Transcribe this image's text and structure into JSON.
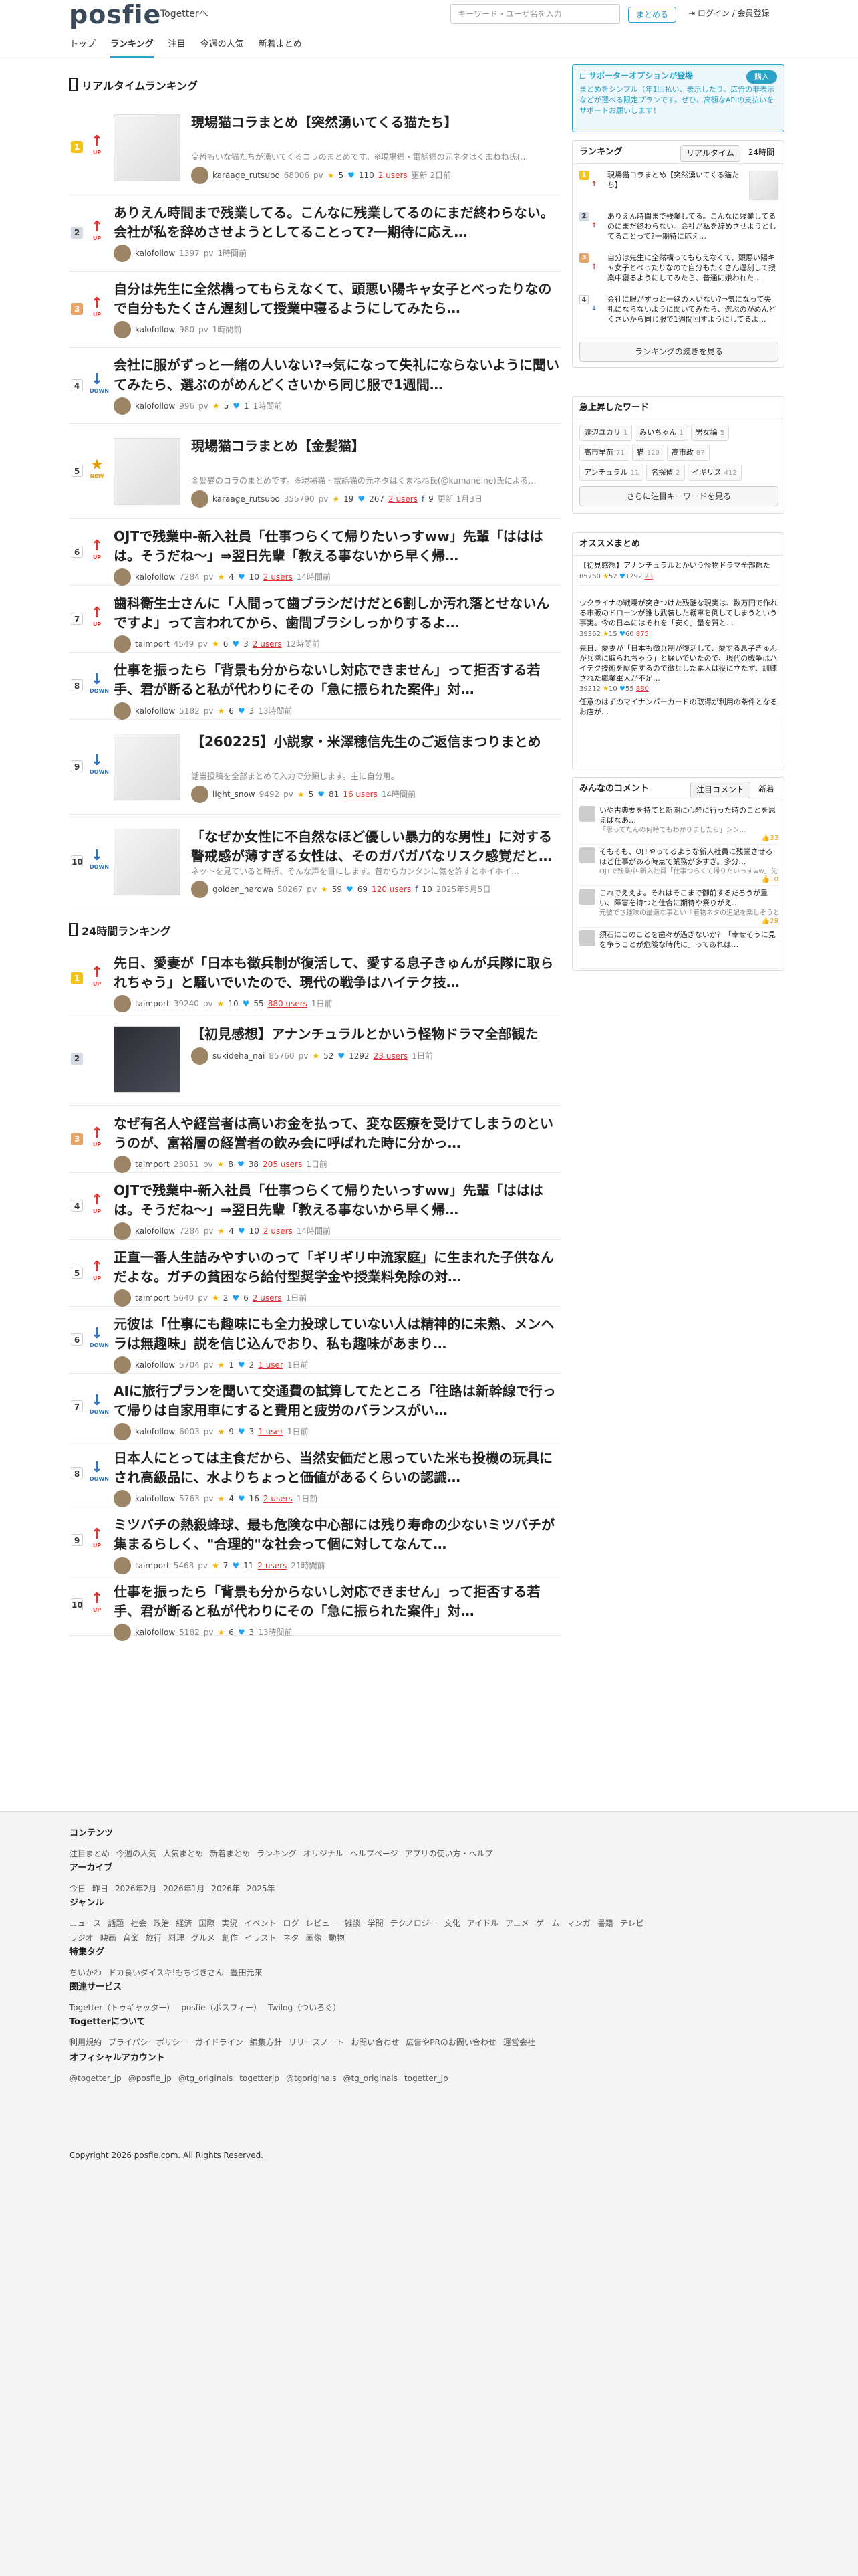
{
  "header": {
    "logo": "posfie",
    "to_togetter": "Togetterへ",
    "search_placeholder": "キーワード・ユーザ名を入力",
    "matome_button": "まとめる",
    "login": "ログイン / 会員登録",
    "nav": [
      "トップ",
      "ランキング",
      "注目",
      "今週の人気",
      "新着まとめ"
    ],
    "nav_active": "ランキング"
  },
  "realtime": {
    "title": "リアルタイムランキング",
    "items": [
      {
        "rank": "1",
        "trend": "UP",
        "title": "現場猫コラまとめ【突然湧いてくる猫たち】",
        "desc": "変哲もいな猫たちが湧いてくるコラのまとめです。※現場猫・電話猫の元ネタはくまねね氏(…",
        "user": "karaage_rutsubo",
        "views": "68006",
        "stars": "5",
        "tweets": "110",
        "users": "2 users",
        "date": "更新 2日前"
      },
      {
        "rank": "2",
        "trend": "UP",
        "title": "ありえん時間まで残業してる。こんなに残業してるのにまだ終わらない。会社が私を辞めさせようとしてることって?一期待に応え…",
        "user": "kalofollow",
        "views": "1397",
        "date": "1時間前"
      },
      {
        "rank": "3",
        "trend": "UP",
        "title": "自分は先生に全然構ってもらえなくて、頭悪い陽キャ女子とべったりなので自分もたくさん遅刻して授業中寝るようにしてみたら…",
        "user": "kalofollow",
        "views": "980",
        "date": "1時間前"
      },
      {
        "rank": "4",
        "trend": "DOWN",
        "title": "会社に服がずっと一緒の人いない?⇒気になって失礼にならないように聞いてみたら、選ぶのがめんどくさいから同じ服で1週間…",
        "user": "kalofollow",
        "views": "996",
        "stars": "5",
        "tweets": "1",
        "date": "1時間前"
      },
      {
        "rank": "5",
        "trend": "NEW",
        "title": "現場猫コラまとめ【金髪猫】",
        "desc": "金髪猫のコラのまとめです。※現場猫・電話猫の元ネタはくまねね氏(@kumaneine)氏による…",
        "user": "karaage_rutsubo",
        "views": "355790",
        "stars": "19",
        "tweets": "267",
        "users": "2 users",
        "fb": "9",
        "date": "更新 1月3日"
      },
      {
        "rank": "6",
        "trend": "UP",
        "title": "OJTで残業中-新入社員「仕事つらくて帰りたいっすww」先輩「はははは。そうだね〜」⇒翌日先輩「教える事ないから早く帰…",
        "user": "kalofollow",
        "views": "7284",
        "stars": "4",
        "tweets": "10",
        "users": "2 users",
        "date": "14時間前"
      },
      {
        "rank": "7",
        "trend": "UP",
        "title": "歯科衛生士さんに「人間って歯ブラシだけだと6割しか汚れ落とせないんですよ」って言われてから、歯間ブラシしっかりするよ…",
        "user": "taimport",
        "views": "4549",
        "stars": "6",
        "tweets": "3",
        "users": "2 users",
        "date": "12時間前"
      },
      {
        "rank": "8",
        "trend": "DOWN",
        "title": "仕事を振ったら「背景も分からないし対応できません」って拒否する若手、君が断ると私が代わりにその「急に振られた案件」対…",
        "user": "kalofollow",
        "views": "5182",
        "stars": "6",
        "tweets": "3",
        "date": "13時間前"
      },
      {
        "rank": "9",
        "trend": "DOWN",
        "title": "【260225】小説家・米澤穂信先生のご返信まつりまとめ",
        "desc": "話当投稿を全部まとめて入力で分類します。主に自分用。",
        "user": "light_snow",
        "views": "9492",
        "stars": "5",
        "tweets": "81",
        "users": "16 users",
        "date": "14時間前"
      },
      {
        "rank": "10",
        "trend": "DOWN",
        "title": "「なぜか女性に不自然なほど優しい暴力的な男性」に対する警戒感が薄すぎる女性は、そのガバガバなリスク感覚だと…",
        "desc": "ネットを見ていると時折、そんな声を目にします。昔からカンタンに気を許すとホイホイ…",
        "user": "golden_harowa",
        "views": "50267",
        "stars": "59",
        "tweets": "69",
        "users": "120 users",
        "fb": "10",
        "date": "2025年5月5日"
      }
    ]
  },
  "daily": {
    "title": "24時間ランキング",
    "items": [
      {
        "rank": "1",
        "trend": "UP",
        "title": "先日、愛妻が「日本も徴兵制が復活して、愛する息子きゅんが兵隊に取られちゃう」と騒いでいたので、現代の戦争はハイテク技…",
        "user": "taimport",
        "views": "39240",
        "stars": "10",
        "tweets": "55",
        "users": "880 users",
        "date": "1日前"
      },
      {
        "rank": "2",
        "trend": "NONE",
        "title": "【初見感想】アナンチュラルとかいう怪物ドラマ全部観た",
        "user": "sukideha_nai",
        "views": "85760",
        "stars": "52",
        "tweets": "1292",
        "users": "23 users",
        "date": "1日前"
      },
      {
        "rank": "3",
        "trend": "UP",
        "title": "なぜ有名人や経営者は高いお金を払って、変な医療を受けてしまうのというのが、富裕層の経営者の飲み会に呼ばれた時に分かっ…",
        "user": "taimport",
        "views": "23051",
        "stars": "8",
        "tweets": "38",
        "users": "205 users",
        "date": "1日前"
      },
      {
        "rank": "4",
        "trend": "UP",
        "title": "OJTで残業中-新入社員「仕事つらくて帰りたいっすww」先輩「はははは。そうだね〜」⇒翌日先輩「教える事ないから早く帰…",
        "user": "kalofollow",
        "views": "7284",
        "stars": "4",
        "tweets": "10",
        "users": "2 users",
        "date": "14時間前"
      },
      {
        "rank": "5",
        "trend": "UP",
        "title": "正直一番人生詰みやすいのって「ギリギリ中流家庭」に生まれた子供なんだよな。ガチの貧困なら給付型奨学金や授業料免除の対…",
        "user": "taimport",
        "views": "5640",
        "stars": "2",
        "tweets": "6",
        "users": "2 users",
        "date": "1日前"
      },
      {
        "rank": "6",
        "trend": "DOWN",
        "title": "元彼は「仕事にも趣味にも全力投球していない人は精神的に未熟、メンヘラは無趣味」説を信じ込んでおり、私も趣味があまり…",
        "user": "kalofollow",
        "views": "5704",
        "stars": "1",
        "tweets": "2",
        "users": "1 user",
        "date": "1日前"
      },
      {
        "rank": "7",
        "trend": "DOWN",
        "title": "AIに旅行プランを聞いて交通費の試算してたところ「往路は新幹線で行って帰りは自家用車にすると費用と疲労のバランスがい…",
        "user": "kalofollow",
        "views": "6003",
        "stars": "9",
        "tweets": "3",
        "users": "1 user",
        "date": "1日前"
      },
      {
        "rank": "8",
        "trend": "DOWN",
        "title": "日本人にとっては主食だから、当然安価だと思っていた米も投機の玩具にされ高級品に、水よりちょっと価値があるくらいの認識…",
        "user": "kalofollow",
        "views": "5763",
        "stars": "4",
        "tweets": "16",
        "users": "2 users",
        "date": "1日前"
      },
      {
        "rank": "9",
        "trend": "UP",
        "title": "ミツバチの熱殺蜂球、最も危険な中心部には残り寿命の少ないミツバチが集まるらしく、\"合理的\"な社会って個に対してなんて…",
        "user": "taimport",
        "views": "5468",
        "stars": "7",
        "tweets": "11",
        "users": "2 users",
        "date": "21時間前"
      },
      {
        "rank": "10",
        "trend": "UP",
        "title": "仕事を振ったら「背景も分からないし対応できません」って拒否する若手、君が断ると私が代わりにその「急に振られた案件」対…",
        "user": "kalofollow",
        "views": "5182",
        "stars": "6",
        "tweets": "3",
        "date": "13時間前"
      }
    ]
  },
  "sidebar": {
    "promo": {
      "head": "サポーターオプションが登場",
      "buy": "購入",
      "body": "まとめをシンプル（年1回払い、表示したり、広告の非表示などが選べる限定プランです。ぜひ、高額なAPIの支払いをサポートお願いします！"
    },
    "ranking": {
      "title": "ランキング",
      "tabs": [
        "リアルタイム",
        "24時間"
      ],
      "items": [
        {
          "n": "1",
          "trend": "UP",
          "text": "現場猫コラまとめ【突然湧いてくる猫たち】"
        },
        {
          "n": "2",
          "trend": "UP",
          "text": "ありえん時間まで残業してる。こんなに残業してるのにまだ終わらない。会社が私を辞めさせようとしてることって?一期待に応え…"
        },
        {
          "n": "3",
          "trend": "UP",
          "text": "自分は先生に全然構ってもらえなくて、頭悪い陽キャ女子とべったりなので自分もたくさん遅刻して授業中寝るようにしてみたら、普通に嫌われた…"
        },
        {
          "n": "4",
          "trend": "DOWN",
          "text": "会社に服がずっと一緒の人いない?⇒気になって失礼にならないように聞いてみたら、選ぶのがめんどくさいから同じ服で1週間回すようにしてるよ…"
        }
      ],
      "more": "ランキングの続きを見る"
    },
    "keywords": {
      "title": "急上昇したワード",
      "items": [
        {
          "w": "渡辺ユカリ",
          "c": "1"
        },
        {
          "w": "みいちゃん",
          "c": "1"
        },
        {
          "w": "男女論",
          "c": "5"
        },
        {
          "w": "高市早苗",
          "c": "71"
        },
        {
          "w": "猫",
          "c": "120"
        },
        {
          "w": "高市政",
          "c": "87"
        },
        {
          "w": "アンチュラル",
          "c": "11"
        },
        {
          "w": "名探偵",
          "c": "2"
        },
        {
          "w": "イギリス",
          "c": "412"
        }
      ],
      "more": "さらに注目キーワードを見る"
    },
    "recommend": {
      "title": "オススメまとめ",
      "items": [
        {
          "t": "【初見感想】アナンチュラルとかいう怪物ドラマ全部観た",
          "views": "85760",
          "stars": "52",
          "tweets": "1292",
          "users": "23"
        },
        {
          "t": "ウクライナの戦場が突きつけた残酷な現実は、数万円で作れる市販のドローンが誰も武装した戦車を倒してしまうという事実。今の日本にはそれを「安く」量を質と…",
          "views": "39362",
          "stars": "15",
          "tweets": "60",
          "users": "875"
        },
        {
          "t": "先日、愛妻が「日本も徴兵制が復活して、愛する息子きゅんが兵隊に取られちゃう」と騒いでいたので、現代の戦争はハイテク技術を駆使するので徴兵した素人は役に立たず、訓練された職業軍人が不足…",
          "views": "39212",
          "stars": "10",
          "tweets": "55",
          "users": "880"
        },
        {
          "t": "任意のはずのマイナンバーカードの取得が利用の条件となるお店が…"
        }
      ]
    },
    "comments": {
      "title": "みんなのコメント",
      "tabs": [
        "注目コメント",
        "新着"
      ],
      "items": [
        {
          "t": "いや古典要を持てと新潮に心酔に行った時のことを思えばなあ…",
          "s": "「思ってたんの何時でもわかりましたら」シン…",
          "lk": "33"
        },
        {
          "t": "そもそも、OJTやってるような新人社員に残業させるほど仕事がある時点で業務が多すぎ。多分…",
          "s": "OJTで残業中-新入社員「仕事つらくて帰りたいっすww」先輩…",
          "lk": "10"
        },
        {
          "t": "これでええよ。それはそこまで御前するだろうが重い、障害を持つと仕合に期待や祭りがえ…",
          "s": "元彼でさ趣味の最適な事とい「着物ネタの追記を楽しそうと…",
          "lk": "29"
        },
        {
          "t": "須石にこのことを歯々が過ぎないか？「幸せそうに見を争うことが危険な時代に」ってあれは…",
          "s": "",
          "lk": ""
        }
      ]
    }
  },
  "footer": {
    "content": {
      "h": "コンテンツ",
      "links": [
        "注目まとめ",
        "今週の人気",
        "人気まとめ",
        "新着まとめ",
        "ランキング",
        "オリジナル",
        "ヘルプページ",
        "アプリの使い方・ヘルプ"
      ]
    },
    "archive": {
      "h": "アーカイブ",
      "links": [
        "今日",
        "昨日",
        "2026年2月",
        "2026年1月",
        "2026年",
        "2025年"
      ]
    },
    "genre": {
      "h": "ジャンル",
      "links": [
        "ニュース",
        "話題",
        "社会",
        "政治",
        "経済",
        "国際",
        "実況",
        "イベント",
        "ログ",
        "レビュー",
        "雑談",
        "学問",
        "テクノロジー",
        "文化",
        "アイドル",
        "アニメ",
        "ゲーム",
        "マンガ",
        "書籍",
        "テレビ",
        "ラジオ",
        "映画",
        "音楽",
        "旅行",
        "料理",
        "グルメ",
        "創作",
        "イラスト",
        "ネタ",
        "画像",
        "動物"
      ]
    },
    "special": {
      "h": "特集タグ",
      "links": [
        "ちいかわ",
        "ドカ食いダイスキ!もちづきさん",
        "豊田元来"
      ]
    },
    "related": {
      "h": "関連サービス",
      "links": [
        "Togetter（トゥギャッター）",
        "posfie（ポスフィー）",
        "Twilog（ついろぐ）"
      ]
    },
    "about": {
      "h": "Togetterについて",
      "links": [
        "利用規約",
        "プライバシーポリシー",
        "ガイドライン",
        "編集方針",
        "リリースノート",
        "お問い合わせ",
        "広告やPRのお問い合わせ",
        "運営会社"
      ]
    },
    "accounts": {
      "h": "オフィシャルアカウント",
      "links": [
        "@togetter_jp",
        "@posfie_jp",
        "@tg_originals",
        "togetterjp",
        "@tgoriginals",
        "@tg_originals",
        "togetter_jp"
      ]
    },
    "copyright": "Copyright 2026 posfie.com. All Rights Reserved."
  }
}
